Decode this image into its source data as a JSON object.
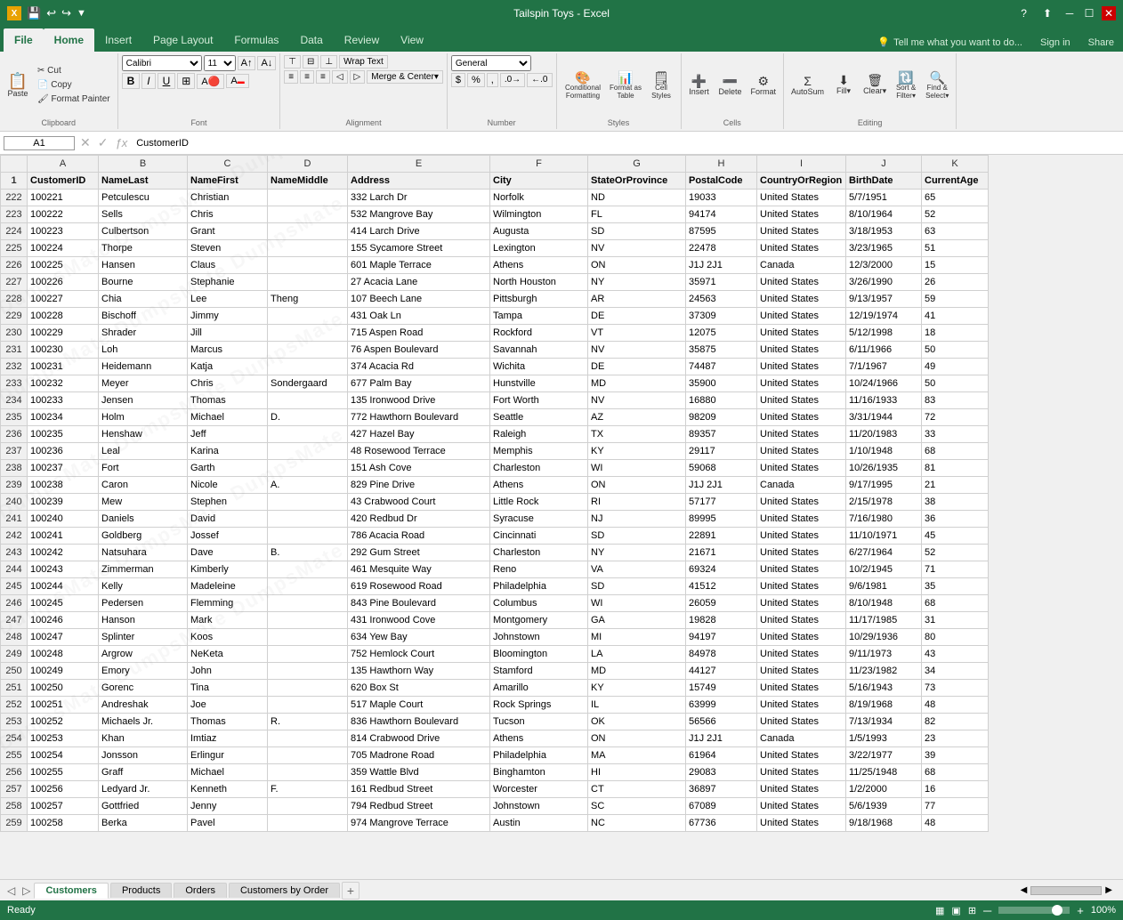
{
  "titleBar": {
    "title": "Tailspin Toys - Excel",
    "quickAccess": [
      "save",
      "undo",
      "redo",
      "customize"
    ]
  },
  "ribbonTabs": [
    "File",
    "Home",
    "Insert",
    "Page Layout",
    "Formulas",
    "Data",
    "Review",
    "View"
  ],
  "activeTab": "Home",
  "formulaBar": {
    "nameBox": "A1",
    "formula": "CustomerID"
  },
  "columns": {
    "A": "CustomerID",
    "B": "NameLast",
    "C": "NameFirst",
    "D": "NameMiddle",
    "E": "Address",
    "F": "City",
    "G": "StateOrProvince",
    "H": "PostalCode",
    "I": "CountryOrRegion",
    "J": "BirthDate",
    "K": "CurrentAge"
  },
  "rows": [
    {
      "row": 222,
      "A": "100221",
      "B": "Petculescu",
      "C": "Christian",
      "D": "",
      "E": "332 Larch Dr",
      "F": "Norfolk",
      "G": "ND",
      "H": "19033",
      "I": "United States",
      "J": "5/7/1951",
      "K": "65"
    },
    {
      "row": 223,
      "A": "100222",
      "B": "Sells",
      "C": "Chris",
      "D": "",
      "E": "532 Mangrove Bay",
      "F": "Wilmington",
      "G": "FL",
      "H": "94174",
      "I": "United States",
      "J": "8/10/1964",
      "K": "52"
    },
    {
      "row": 224,
      "A": "100223",
      "B": "Culbertson",
      "C": "Grant",
      "D": "",
      "E": "414 Larch Drive",
      "F": "Augusta",
      "G": "SD",
      "H": "87595",
      "I": "United States",
      "J": "3/18/1953",
      "K": "63"
    },
    {
      "row": 225,
      "A": "100224",
      "B": "Thorpe",
      "C": "Steven",
      "D": "",
      "E": "155 Sycamore Street",
      "F": "Lexington",
      "G": "NV",
      "H": "22478",
      "I": "United States",
      "J": "3/23/1965",
      "K": "51"
    },
    {
      "row": 226,
      "A": "100225",
      "B": "Hansen",
      "C": "Claus",
      "D": "",
      "E": "601 Maple Terrace",
      "F": "Athens",
      "G": "ON",
      "H": "J1J 2J1",
      "I": "Canada",
      "J": "12/3/2000",
      "K": "15"
    },
    {
      "row": 227,
      "A": "100226",
      "B": "Bourne",
      "C": "Stephanie",
      "D": "",
      "E": "27 Acacia Lane",
      "F": "North Houston",
      "G": "NY",
      "H": "35971",
      "I": "United States",
      "J": "3/26/1990",
      "K": "26"
    },
    {
      "row": 228,
      "A": "100227",
      "B": "Chia",
      "C": "Lee",
      "D": "Theng",
      "E": "107 Beech Lane",
      "F": "Pittsburgh",
      "G": "AR",
      "H": "24563",
      "I": "United States",
      "J": "9/13/1957",
      "K": "59"
    },
    {
      "row": 229,
      "A": "100228",
      "B": "Bischoff",
      "C": "Jimmy",
      "D": "",
      "E": "431 Oak Ln",
      "F": "Tampa",
      "G": "DE",
      "H": "37309",
      "I": "United States",
      "J": "12/19/1974",
      "K": "41"
    },
    {
      "row": 230,
      "A": "100229",
      "B": "Shrader",
      "C": "Jill",
      "D": "",
      "E": "715 Aspen Road",
      "F": "Rockford",
      "G": "VT",
      "H": "12075",
      "I": "United States",
      "J": "5/12/1998",
      "K": "18"
    },
    {
      "row": 231,
      "A": "100230",
      "B": "Loh",
      "C": "Marcus",
      "D": "",
      "E": "76 Aspen Boulevard",
      "F": "Savannah",
      "G": "NV",
      "H": "35875",
      "I": "United States",
      "J": "6/11/1966",
      "K": "50"
    },
    {
      "row": 232,
      "A": "100231",
      "B": "Heidemann",
      "C": "Katja",
      "D": "",
      "E": "374 Acacia Rd",
      "F": "Wichita",
      "G": "DE",
      "H": "74487",
      "I": "United States",
      "J": "7/1/1967",
      "K": "49"
    },
    {
      "row": 233,
      "A": "100232",
      "B": "Meyer",
      "C": "Chris",
      "D": "Sondergaard",
      "E": "677 Palm Bay",
      "F": "Hunstville",
      "G": "MD",
      "H": "35900",
      "I": "United States",
      "J": "10/24/1966",
      "K": "50"
    },
    {
      "row": 234,
      "A": "100233",
      "B": "Jensen",
      "C": "Thomas",
      "D": "",
      "E": "135 Ironwood Drive",
      "F": "Fort Worth",
      "G": "NV",
      "H": "16880",
      "I": "United States",
      "J": "11/16/1933",
      "K": "83"
    },
    {
      "row": 235,
      "A": "100234",
      "B": "Holm",
      "C": "Michael",
      "D": "D.",
      "E": "772 Hawthorn Boulevard",
      "F": "Seattle",
      "G": "AZ",
      "H": "98209",
      "I": "United States",
      "J": "3/31/1944",
      "K": "72"
    },
    {
      "row": 236,
      "A": "100235",
      "B": "Henshaw",
      "C": "Jeff",
      "D": "",
      "E": "427 Hazel Bay",
      "F": "Raleigh",
      "G": "TX",
      "H": "89357",
      "I": "United States",
      "J": "11/20/1983",
      "K": "33"
    },
    {
      "row": 237,
      "A": "100236",
      "B": "Leal",
      "C": "Karina",
      "D": "",
      "E": "48 Rosewood Terrace",
      "F": "Memphis",
      "G": "KY",
      "H": "29117",
      "I": "United States",
      "J": "1/10/1948",
      "K": "68"
    },
    {
      "row": 238,
      "A": "100237",
      "B": "Fort",
      "C": "Garth",
      "D": "",
      "E": "151 Ash Cove",
      "F": "Charleston",
      "G": "WI",
      "H": "59068",
      "I": "United States",
      "J": "10/26/1935",
      "K": "81"
    },
    {
      "row": 239,
      "A": "100238",
      "B": "Caron",
      "C": "Nicole",
      "D": "A.",
      "E": "829 Pine Drive",
      "F": "Athens",
      "G": "ON",
      "H": "J1J 2J1",
      "I": "Canada",
      "J": "9/17/1995",
      "K": "21"
    },
    {
      "row": 240,
      "A": "100239",
      "B": "Mew",
      "C": "Stephen",
      "D": "",
      "E": "43 Crabwood Court",
      "F": "Little Rock",
      "G": "RI",
      "H": "57177",
      "I": "United States",
      "J": "2/15/1978",
      "K": "38"
    },
    {
      "row": 241,
      "A": "100240",
      "B": "Daniels",
      "C": "David",
      "D": "",
      "E": "420 Redbud Dr",
      "F": "Syracuse",
      "G": "NJ",
      "H": "89995",
      "I": "United States",
      "J": "7/16/1980",
      "K": "36"
    },
    {
      "row": 242,
      "A": "100241",
      "B": "Goldberg",
      "C": "Jossef",
      "D": "",
      "E": "786 Acacia Road",
      "F": "Cincinnati",
      "G": "SD",
      "H": "22891",
      "I": "United States",
      "J": "11/10/1971",
      "K": "45"
    },
    {
      "row": 243,
      "A": "100242",
      "B": "Natsuhara",
      "C": "Dave",
      "D": "B.",
      "E": "292 Gum Street",
      "F": "Charleston",
      "G": "NY",
      "H": "21671",
      "I": "United States",
      "J": "6/27/1964",
      "K": "52"
    },
    {
      "row": 244,
      "A": "100243",
      "B": "Zimmerman",
      "C": "Kimberly",
      "D": "",
      "E": "461 Mesquite Way",
      "F": "Reno",
      "G": "VA",
      "H": "69324",
      "I": "United States",
      "J": "10/2/1945",
      "K": "71"
    },
    {
      "row": 245,
      "A": "100244",
      "B": "Kelly",
      "C": "Madeleine",
      "D": "",
      "E": "619 Rosewood Road",
      "F": "Philadelphia",
      "G": "SD",
      "H": "41512",
      "I": "United States",
      "J": "9/6/1981",
      "K": "35"
    },
    {
      "row": 246,
      "A": "100245",
      "B": "Pedersen",
      "C": "Flemming",
      "D": "",
      "E": "843 Pine Boulevard",
      "F": "Columbus",
      "G": "WI",
      "H": "26059",
      "I": "United States",
      "J": "8/10/1948",
      "K": "68"
    },
    {
      "row": 247,
      "A": "100246",
      "B": "Hanson",
      "C": "Mark",
      "D": "",
      "E": "431 Ironwood Cove",
      "F": "Montgomery",
      "G": "GA",
      "H": "19828",
      "I": "United States",
      "J": "11/17/1985",
      "K": "31"
    },
    {
      "row": 248,
      "A": "100247",
      "B": "Splinter",
      "C": "Koos",
      "D": "",
      "E": "634 Yew Bay",
      "F": "Johnstown",
      "G": "MI",
      "H": "94197",
      "I": "United States",
      "J": "10/29/1936",
      "K": "80"
    },
    {
      "row": 249,
      "A": "100248",
      "B": "Argrow",
      "C": "NeKeta",
      "D": "",
      "E": "752 Hemlock Court",
      "F": "Bloomington",
      "G": "LA",
      "H": "84978",
      "I": "United States",
      "J": "9/11/1973",
      "K": "43"
    },
    {
      "row": 250,
      "A": "100249",
      "B": "Emory",
      "C": "John",
      "D": "",
      "E": "135 Hawthorn Way",
      "F": "Stamford",
      "G": "MD",
      "H": "44127",
      "I": "United States",
      "J": "11/23/1982",
      "K": "34"
    },
    {
      "row": 251,
      "A": "100250",
      "B": "Gorenc",
      "C": "Tina",
      "D": "",
      "E": "620 Box St",
      "F": "Amarillo",
      "G": "KY",
      "H": "15749",
      "I": "United States",
      "J": "5/16/1943",
      "K": "73"
    },
    {
      "row": 252,
      "A": "100251",
      "B": "Andreshak",
      "C": "Joe",
      "D": "",
      "E": "517 Maple Court",
      "F": "Rock Springs",
      "G": "IL",
      "H": "63999",
      "I": "United States",
      "J": "8/19/1968",
      "K": "48"
    },
    {
      "row": 253,
      "A": "100252",
      "B": "Michaels Jr.",
      "C": "Thomas",
      "D": "R.",
      "E": "836 Hawthorn Boulevard",
      "F": "Tucson",
      "G": "OK",
      "H": "56566",
      "I": "United States",
      "J": "7/13/1934",
      "K": "82"
    },
    {
      "row": 254,
      "A": "100253",
      "B": "Khan",
      "C": "Imtiaz",
      "D": "",
      "E": "814 Crabwood Drive",
      "F": "Athens",
      "G": "ON",
      "H": "J1J 2J1",
      "I": "Canada",
      "J": "1/5/1993",
      "K": "23"
    },
    {
      "row": 255,
      "A": "100254",
      "B": "Jonsson",
      "C": "Erlingur",
      "D": "",
      "E": "705 Madrone Road",
      "F": "Philadelphia",
      "G": "MA",
      "H": "61964",
      "I": "United States",
      "J": "3/22/1977",
      "K": "39"
    },
    {
      "row": 256,
      "A": "100255",
      "B": "Graff",
      "C": "Michael",
      "D": "",
      "E": "359 Wattle Blvd",
      "F": "Binghamton",
      "G": "HI",
      "H": "29083",
      "I": "United States",
      "J": "11/25/1948",
      "K": "68"
    },
    {
      "row": 257,
      "A": "100256",
      "B": "Ledyard Jr.",
      "C": "Kenneth",
      "D": "F.",
      "E": "161 Redbud Street",
      "F": "Worcester",
      "G": "CT",
      "H": "36897",
      "I": "United States",
      "J": "1/2/2000",
      "K": "16"
    },
    {
      "row": 258,
      "A": "100257",
      "B": "Gottfried",
      "C": "Jenny",
      "D": "",
      "E": "794 Redbud Street",
      "F": "Johnstown",
      "G": "SC",
      "H": "67089",
      "I": "United States",
      "J": "5/6/1939",
      "K": "77"
    },
    {
      "row": 259,
      "A": "100258",
      "B": "Berka",
      "C": "Pavel",
      "D": "",
      "E": "974 Mangrove Terrace",
      "F": "Austin",
      "G": "NC",
      "H": "67736",
      "I": "United States",
      "J": "9/18/1968",
      "K": "48"
    }
  ],
  "sheetTabs": [
    "Customers",
    "Products",
    "Orders",
    "Customers by Order"
  ],
  "activeSheet": "Customers",
  "statusBar": {
    "left": "Ready",
    "right": "100%"
  },
  "toolbar": {
    "fontFamily": "Calibri",
    "fontSize": "11",
    "numberFormat": "General"
  }
}
